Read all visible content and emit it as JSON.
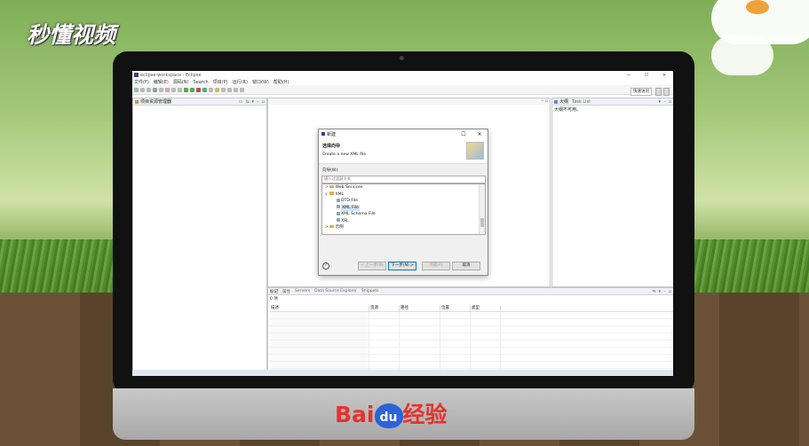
{
  "watermark": {
    "brand": "秒懂视频",
    "footer_brand": "Bai",
    "footer_du": "du",
    "footer_suffix": "经验"
  },
  "window": {
    "title": "eclipse-workspace - Eclipse",
    "controls": [
      "—",
      "☐",
      "✕"
    ]
  },
  "menu": [
    "文件(F)",
    "编辑(E)",
    "源码(N)",
    "Search",
    "项目(P)",
    "运行(R)",
    "窗口(W)",
    "帮助(H)"
  ],
  "toolbar": {
    "quick_access": "快速访问"
  },
  "left_pane": {
    "title": "项目资源管理器"
  },
  "outline_pane": {
    "tab_outline": "大纲",
    "tab_tasks": "Task List",
    "message": "大纲不可用。"
  },
  "bottom_pane": {
    "tabs": [
      "标记",
      "属性",
      "Servers",
      "Data Source Explorer",
      "Snippets"
    ],
    "count": "0 项",
    "columns": [
      "描述",
      "资源",
      "路径",
      "位置",
      "类型"
    ]
  },
  "dialog": {
    "title": "新建",
    "heading": "选择向导",
    "subtitle": "Create a new XML file",
    "wizards_label": "向导(W):",
    "filter_placeholder": "输入过滤器文本",
    "tree": [
      {
        "label": "Web Services",
        "level": 0,
        "kind": "folder",
        "twisty": ">"
      },
      {
        "label": "XML",
        "level": 0,
        "kind": "folder",
        "twisty": "v"
      },
      {
        "label": "DTD File",
        "level": 1,
        "kind": "file"
      },
      {
        "label": "XML File",
        "level": 1,
        "kind": "file",
        "selected": true
      },
      {
        "label": "XML Schema File",
        "level": 1,
        "kind": "file"
      },
      {
        "label": "XSL",
        "level": 1,
        "kind": "file"
      },
      {
        "label": "示例",
        "level": 0,
        "kind": "folder",
        "twisty": ">"
      }
    ],
    "buttons": {
      "back": "< 上一步(B)",
      "next": "下一步(N) >",
      "finish": "完成(F)",
      "cancel": "取消"
    },
    "help": "?"
  }
}
